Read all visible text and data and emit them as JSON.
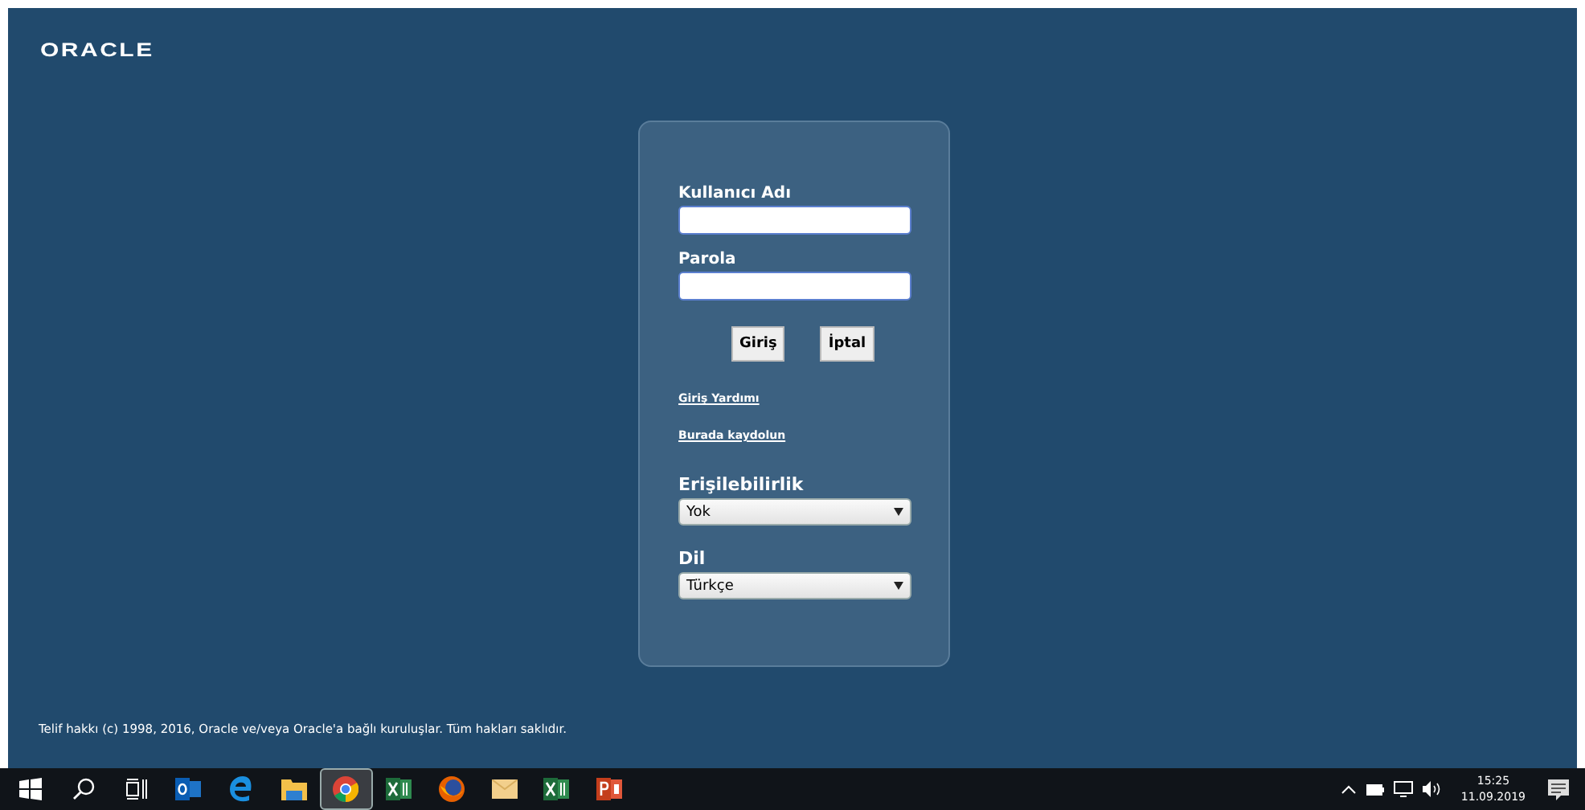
{
  "logo": "ORACLE",
  "login": {
    "username_label": "Kullanıcı Adı",
    "password_label": "Parola",
    "buttons": [
      {
        "label": "Giriş"
      },
      {
        "label": "İptal"
      }
    ],
    "links": [
      "Giriş Yardımı",
      "Burada kaydolun"
    ],
    "accessibility": {
      "label": "Erişilebilirlik",
      "value": "Yok"
    },
    "language": {
      "label": "Dil",
      "value": "Türkçe"
    }
  },
  "copyright": "Telif hakkı (c) 1998, 2016, Oracle ve/veya Oracle'a bağlı kuruluşlar. Tüm hakları saklıdır.",
  "taskbar": {
    "items": [
      {
        "kind": "start",
        "selected": false
      },
      {
        "kind": "search",
        "selected": false
      },
      {
        "kind": "taskview",
        "selected": false
      },
      {
        "kind": "outlook",
        "selected": false
      },
      {
        "kind": "edge",
        "selected": false
      },
      {
        "kind": "explorer",
        "selected": false
      },
      {
        "kind": "chrome",
        "selected": true
      },
      {
        "kind": "excel",
        "selected": false
      },
      {
        "kind": "firefox",
        "selected": false
      },
      {
        "kind": "mail",
        "selected": false
      },
      {
        "kind": "excel",
        "selected": false
      },
      {
        "kind": "powerpoint",
        "selected": false
      }
    ],
    "time": "15:25",
    "date": "11.09.2019"
  }
}
